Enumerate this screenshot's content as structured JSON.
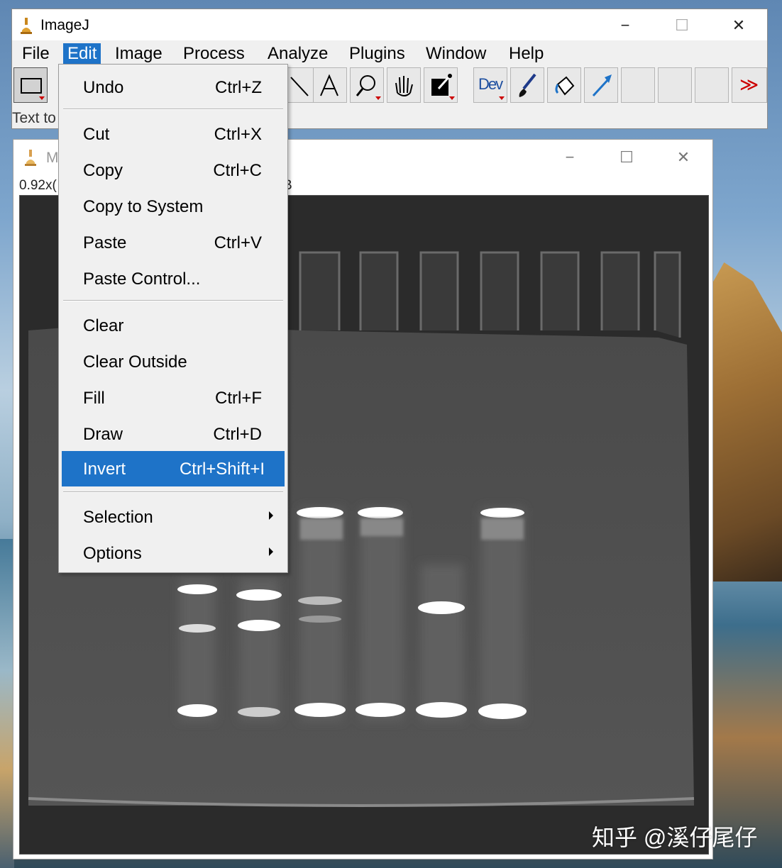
{
  "main_window": {
    "title": "ImageJ",
    "controls": {
      "minimize": "−",
      "maximize": "☐",
      "close": "✕"
    },
    "menu": [
      "File",
      "Edit",
      "Image",
      "Process",
      "Analyze",
      "Plugins",
      "Window",
      "Help"
    ],
    "active_menu": "Edit",
    "status_text": "Text to",
    "toolbar": {
      "dev_label": "Dev",
      "more_label": "≫",
      "tools": [
        "rectangle-icon",
        "line-icon",
        "text-icon",
        "magnifier-icon",
        "hand-icon",
        "color-picker-icon",
        "dev-icon",
        "brush-icon",
        "flood-fill-icon",
        "arrow-icon"
      ]
    }
  },
  "image_window": {
    "title_fragment": "M",
    "info_left": "0.92x(",
    "info_right": "B",
    "controls": {
      "minimize": "−",
      "maximize": "☐",
      "close": "✕"
    }
  },
  "edit_menu": {
    "items": [
      {
        "label": "Undo",
        "shortcut": "Ctrl+Z"
      },
      {
        "label": "Cut",
        "shortcut": "Ctrl+X"
      },
      {
        "label": "Copy",
        "shortcut": "Ctrl+C"
      },
      {
        "label": "Copy to System",
        "shortcut": ""
      },
      {
        "label": "Paste",
        "shortcut": "Ctrl+V"
      },
      {
        "label": "Paste Control...",
        "shortcut": ""
      },
      {
        "label": "Clear",
        "shortcut": ""
      },
      {
        "label": "Clear Outside",
        "shortcut": ""
      },
      {
        "label": "Fill",
        "shortcut": "Ctrl+F"
      },
      {
        "label": "Draw",
        "shortcut": "Ctrl+D"
      },
      {
        "label": "Invert",
        "shortcut": "Ctrl+Shift+I"
      },
      {
        "label": "Selection",
        "shortcut": ""
      },
      {
        "label": "Options",
        "shortcut": ""
      }
    ],
    "highlighted": "Invert"
  },
  "watermark": "知乎 @溪仔尾仔",
  "colors": {
    "highlight": "#1e73c8",
    "gel_bg": "#2d2d2d"
  }
}
